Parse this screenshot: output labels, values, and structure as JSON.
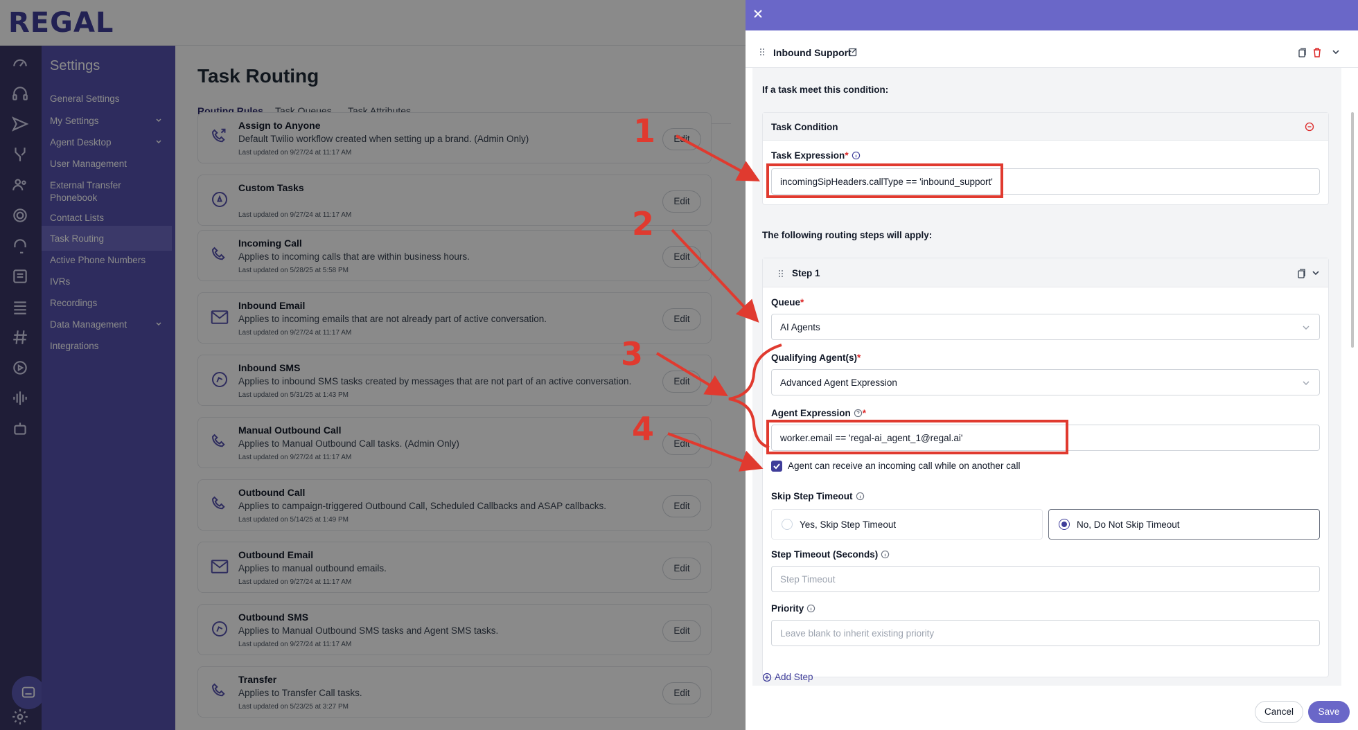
{
  "app": {
    "logo": "REGAL"
  },
  "settings_nav": {
    "title": "Settings",
    "items": [
      {
        "label": "General Settings",
        "chevron": false
      },
      {
        "label": "My Settings",
        "chevron": true
      },
      {
        "label": "Agent Desktop",
        "chevron": true
      },
      {
        "label": "User Management",
        "chevron": false
      },
      {
        "label": "External Transfer Phonebook",
        "chevron": false
      },
      {
        "label": "Contact Lists",
        "chevron": false
      },
      {
        "label": "Task Routing",
        "chevron": false,
        "active": true
      },
      {
        "label": "Active Phone Numbers",
        "chevron": false
      },
      {
        "label": "IVRs",
        "chevron": false
      },
      {
        "label": "Recordings",
        "chevron": false
      },
      {
        "label": "Data Management",
        "chevron": true
      },
      {
        "label": "Integrations",
        "chevron": false
      }
    ]
  },
  "rail_icons": [
    "dashboard-icon",
    "headset-icon",
    "send-icon",
    "branch-icon",
    "users-icon",
    "target-icon",
    "support-icon",
    "list-icon",
    "menu-icon",
    "hash-icon",
    "play-icon",
    "waveform-icon",
    "robot-icon"
  ],
  "rail_bottom_icons": [
    "chat-icon",
    "bar-chart-icon",
    "gear-icon"
  ],
  "main": {
    "title": "Task Routing",
    "tabs": [
      "Routing Rules",
      "Task Queues",
      "Task Attributes"
    ],
    "active_tab": "Routing Rules",
    "edit_label": "Edit",
    "rules": [
      {
        "name": "Assign to Anyone",
        "desc": "Default Twilio workflow created when setting up a brand. (Admin Only)",
        "meta": "Last updated on 9/27/24 at 11:17 AM",
        "icon": "phone-transfer-icon"
      },
      {
        "name": "Custom Tasks",
        "desc": "",
        "meta": "Last updated on 9/27/24 at 11:17 AM",
        "icon": "compass-icon"
      },
      {
        "name": "Incoming Call",
        "desc": "Applies to incoming calls that are within business hours.",
        "meta": "Last updated on 5/28/25 at 5:58 PM",
        "icon": "phone-icon"
      },
      {
        "name": "Inbound Email",
        "desc": "Applies to incoming emails that are not already part of active conversation.",
        "meta": "Last updated on 9/27/24 at 11:17 AM",
        "icon": "mail-icon"
      },
      {
        "name": "Inbound SMS",
        "desc": "Applies to inbound SMS tasks created by messages that are not part of an active conversation.",
        "meta": "Last updated on 5/31/25 at 1:43 PM",
        "icon": "sms-icon"
      },
      {
        "name": "Manual Outbound Call",
        "desc": "Applies to Manual Outbound Call tasks. (Admin Only)",
        "meta": "Last updated on 9/27/24 at 11:17 AM",
        "icon": "phone-icon"
      },
      {
        "name": "Outbound Call",
        "desc": "Applies to campaign-triggered Outbound Call, Scheduled Callbacks and ASAP callbacks.",
        "meta": "Last updated on 5/14/25 at 1:49 PM",
        "icon": "phone-icon"
      },
      {
        "name": "Outbound Email",
        "desc": "Applies to manual outbound emails.",
        "meta": "Last updated on 9/27/24 at 11:17 AM",
        "icon": "mail-icon"
      },
      {
        "name": "Outbound SMS",
        "desc": "Applies to Manual Outbound SMS tasks and Agent SMS tasks.",
        "meta": "Last updated on 9/27/24 at 11:17 AM",
        "icon": "sms-icon"
      },
      {
        "name": "Transfer",
        "desc": "Applies to Transfer Call tasks.",
        "meta": "Last updated on 5/23/25 at 3:27 PM",
        "icon": "phone-icon"
      }
    ]
  },
  "panel": {
    "rule_name": "Inbound Support",
    "condition_heading": "If a task meet this condition:",
    "task_condition_label": "Task Condition",
    "task_expression_label": "Task Expression",
    "task_expression_value": "incomingSipHeaders.callType == 'inbound_support'",
    "steps_heading": "The following routing steps will apply:",
    "step_title": "Step 1",
    "queue_label": "Queue",
    "queue_value": "AI Agents",
    "qualifying_label": "Qualifying Agent(s)",
    "qualifying_value": "Advanced Agent Expression",
    "agent_expr_label": "Agent Expression",
    "agent_expr_value": "worker.email == 'regal-ai_agent_1@regal.ai'",
    "concurrent_label": "Agent can receive an incoming call while on another call",
    "concurrent_checked": true,
    "skip_timeout_label": "Skip Step Timeout",
    "skip_yes": "Yes, Skip Step Timeout",
    "skip_no": "No, Do Not Skip Timeout",
    "skip_selected": "no",
    "step_timeout_label": "Step Timeout (Seconds)",
    "step_timeout_placeholder": "Step Timeout",
    "priority_label": "Priority",
    "priority_placeholder": "Leave blank to inherit existing priority",
    "add_step": "Add Step",
    "cancel": "Cancel",
    "save": "Save",
    "required_mark": "*"
  },
  "annotations": {
    "numbers": [
      "1",
      "2",
      "3",
      "4"
    ],
    "color": "#e03a2f"
  },
  "colors": {
    "brand": "#3f3d9a",
    "panel_header": "#6a67c8",
    "nav": "#5652ae",
    "rail": "#3a3766"
  }
}
